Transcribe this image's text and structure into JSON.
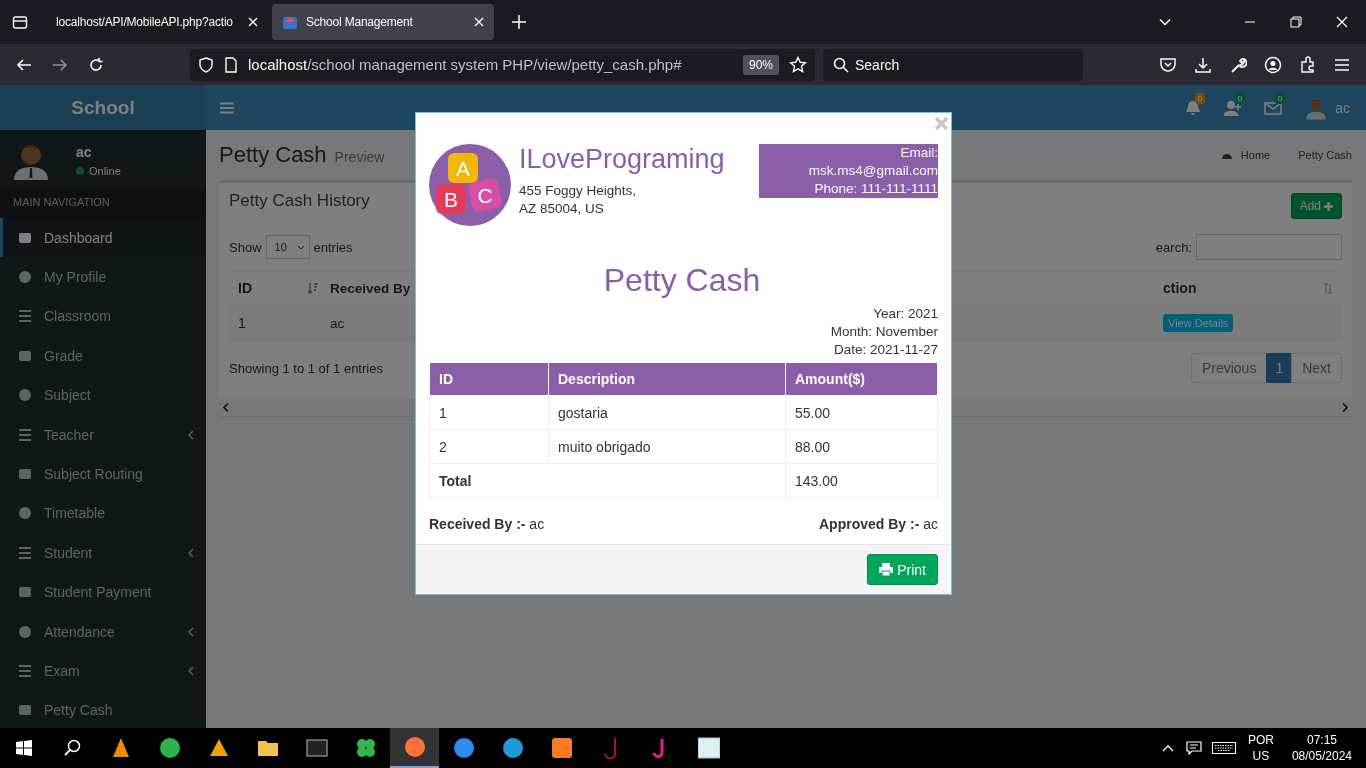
{
  "browser": {
    "tabs": [
      {
        "title": "localhost/API/MobileAPI.php?actio",
        "selected": false
      },
      {
        "title": "School Management",
        "selected": true
      }
    ],
    "url_host": "localhost",
    "url_path": "/school management system PHP/view/petty_cash.php#",
    "zoom": "90%",
    "search_placeholder": "Search"
  },
  "app": {
    "brand": "School",
    "user": {
      "name": "ac",
      "status": "Online"
    },
    "nav_header": "MAIN NAVIGATION",
    "nav": [
      {
        "label": "Dashboard",
        "selected": true,
        "submenu": false
      },
      {
        "label": "My Profile",
        "selected": false,
        "submenu": false
      },
      {
        "label": "Classroom",
        "selected": false,
        "submenu": false
      },
      {
        "label": "Grade",
        "selected": false,
        "submenu": false
      },
      {
        "label": "Subject",
        "selected": false,
        "submenu": false
      },
      {
        "label": "Teacher",
        "selected": false,
        "submenu": true
      },
      {
        "label": "Subject Routing",
        "selected": false,
        "submenu": false
      },
      {
        "label": "Timetable",
        "selected": false,
        "submenu": false
      },
      {
        "label": "Student",
        "selected": false,
        "submenu": true
      },
      {
        "label": "Student Payment",
        "selected": false,
        "submenu": false
      },
      {
        "label": "Attendance",
        "selected": false,
        "submenu": true
      },
      {
        "label": "Exam",
        "selected": false,
        "submenu": true
      },
      {
        "label": "Petty Cash",
        "selected": false,
        "submenu": false
      }
    ],
    "topbar": {
      "badges": [
        {
          "count": "0",
          "color": "#7a4e09"
        },
        {
          "count": "0",
          "color": "#00532d"
        },
        {
          "count": "0",
          "color": "#00532d"
        }
      ],
      "user": "ac"
    },
    "page": {
      "title": "Petty Cash",
      "subtitle": "Preview",
      "breadcrumb": [
        "Home",
        "Petty Cash"
      ]
    },
    "box": {
      "title": "Petty Cash History",
      "add_button": "Add",
      "show_label": "Show",
      "page_size": "10",
      "entries_label": "entries",
      "search_label": "earch:",
      "columns": [
        "ID",
        "Received By",
        "ction"
      ],
      "rows": [
        [
          "1",
          "ac",
          "View Details"
        ]
      ],
      "info": "Showing 1 to 1 of 1 entries",
      "pagination": [
        {
          "label": "Previous",
          "selected": false
        },
        {
          "label": "1",
          "selected": true
        },
        {
          "label": "Next",
          "selected": false
        }
      ]
    }
  },
  "modal": {
    "logo_letters": [
      "A",
      "B",
      "C"
    ],
    "company": "ILovePrograming",
    "address": [
      "455 Foggy Heights,",
      "AZ 85004, US"
    ],
    "contact": [
      "Email:",
      "msk.ms4@gmail.com",
      "Phone: 111-111-1111"
    ],
    "title": "Petty Cash",
    "meta": [
      "Year: 2021",
      "Month: November",
      "Date: 2021-11-27"
    ],
    "columns": [
      "ID",
      "Description",
      "Amount($)"
    ],
    "rows": [
      [
        "1",
        "gostaria",
        "55.00"
      ],
      [
        "2",
        "muito obrigado",
        "88.00"
      ]
    ],
    "total_label": "Total",
    "total": "143.00",
    "received": {
      "label": "Received By :-",
      "value": " ac"
    },
    "approved": {
      "label": "Approved By :-",
      "value": " ac"
    },
    "print_button": "Print"
  },
  "taskbar": {
    "apps": [
      {
        "selected": false
      },
      {
        "selected": false
      },
      {
        "selected": false
      },
      {
        "selected": false
      },
      {
        "selected": false
      },
      {
        "selected": false
      },
      {
        "selected": true
      },
      {
        "selected": false
      },
      {
        "selected": false
      },
      {
        "selected": false
      },
      {
        "selected": false
      },
      {
        "selected": false
      },
      {
        "selected": false
      }
    ],
    "language": "POR",
    "region": "US",
    "time": "07:15",
    "date": "08/05/2024"
  }
}
